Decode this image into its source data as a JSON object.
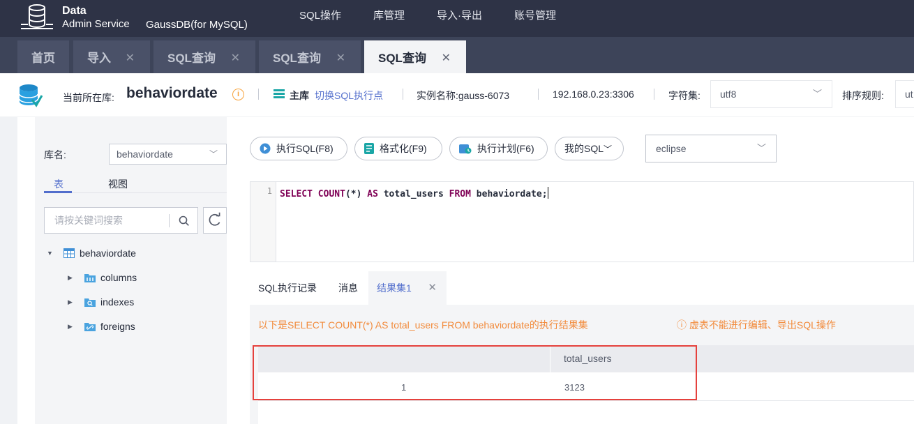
{
  "header": {
    "logo_title": "Data",
    "logo_sub": "Admin Service",
    "product": "GaussDB(for MySQL)",
    "nav": [
      "SQL操作",
      "库管理",
      "导入·导出",
      "账号管理"
    ]
  },
  "tabs": [
    {
      "label": "首页"
    },
    {
      "label": "导入"
    },
    {
      "label": "SQL查询"
    },
    {
      "label": "SQL查询"
    },
    {
      "label": "SQL查询"
    }
  ],
  "tab_close": "✕",
  "info": {
    "current_label": "当前所在库:",
    "current_db": "behaviordate",
    "main_label": "主库",
    "switch_link": "切换SQL执行点",
    "instance": "实例名称:gauss-6073",
    "ip": "192.168.0.23:3306",
    "charset_label": "字符集:",
    "charset_value": "utf8",
    "sort_label": "排序规则:",
    "sort_value": "ut"
  },
  "left": {
    "dbname_label": "库名:",
    "dbname_value": "behaviordate",
    "subtabs": [
      "表",
      "视图"
    ],
    "search_placeholder": "请按关键词搜索",
    "tree": {
      "root": "behaviordate",
      "children": [
        "columns",
        "indexes",
        "foreigns"
      ]
    }
  },
  "toolbar": {
    "run": "执行SQL(F8)",
    "format": "格式化(F9)",
    "plan": "执行计划(F6)",
    "mysql": "我的SQL",
    "theme": "eclipse"
  },
  "editor": {
    "line_number": "1",
    "tokens": [
      {
        "t": "SELECT",
        "kw": true
      },
      {
        "t": " ",
        "kw": false
      },
      {
        "t": "COUNT",
        "kw": true
      },
      {
        "t": "(*) ",
        "kw": false
      },
      {
        "t": "AS",
        "kw": true
      },
      {
        "t": " total_users ",
        "kw": false
      },
      {
        "t": "FROM",
        "kw": true
      },
      {
        "t": " behaviordate;",
        "kw": false
      }
    ]
  },
  "results": {
    "tabs": [
      "SQL执行记录",
      "消息",
      "结果集1"
    ],
    "message": "以下是SELECT COUNT(*) AS total_users FROM behaviordate的执行结果集",
    "warning": "ⓘ 虚表不能进行编辑、导出SQL操作",
    "column": "total_users",
    "row_index": "1",
    "row_value": "3123"
  },
  "colors": {
    "topbar": "#2e3346",
    "accent": "#526ecc",
    "warning": "#f28b3c",
    "highlight": "#e5413d"
  }
}
